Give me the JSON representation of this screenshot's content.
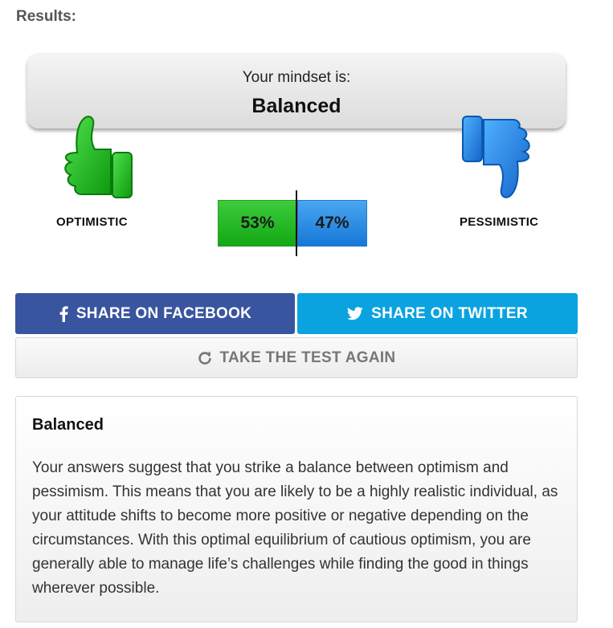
{
  "results_label": "Results:",
  "mindset": {
    "intro": "Your mindset is:",
    "value": "Balanced"
  },
  "scale": {
    "left_label": "OPTIMISTIC",
    "right_label": "PESSIMISTIC",
    "left_icon": "thumbs-up-icon",
    "right_icon": "thumbs-down-icon",
    "optimistic_percent": "53%",
    "pessimistic_percent": "47%",
    "colors": {
      "optimistic": "#14b814",
      "pessimistic": "#1e88e5"
    }
  },
  "actions": {
    "facebook_label": "SHARE ON FACEBOOK",
    "facebook_icon": "facebook-icon",
    "twitter_label": "SHARE ON TWITTER",
    "twitter_icon": "twitter-icon",
    "retake_label": "TAKE THE TEST AGAIN",
    "retake_icon": "refresh-icon",
    "colors": {
      "facebook": "#3a559f",
      "twitter": "#0aa3e0"
    }
  },
  "description": {
    "title": "Balanced",
    "body": "Your answers suggest that you strike a balance between optimism and pessimism. This means that you are likely to be a highly realistic individual, as your attitude shifts to become more positive or negative depending on the circumstances. With this optimal equilibrium of cautious optimism, you are generally able to manage life’s challenges while finding the good in things wherever possible."
  }
}
